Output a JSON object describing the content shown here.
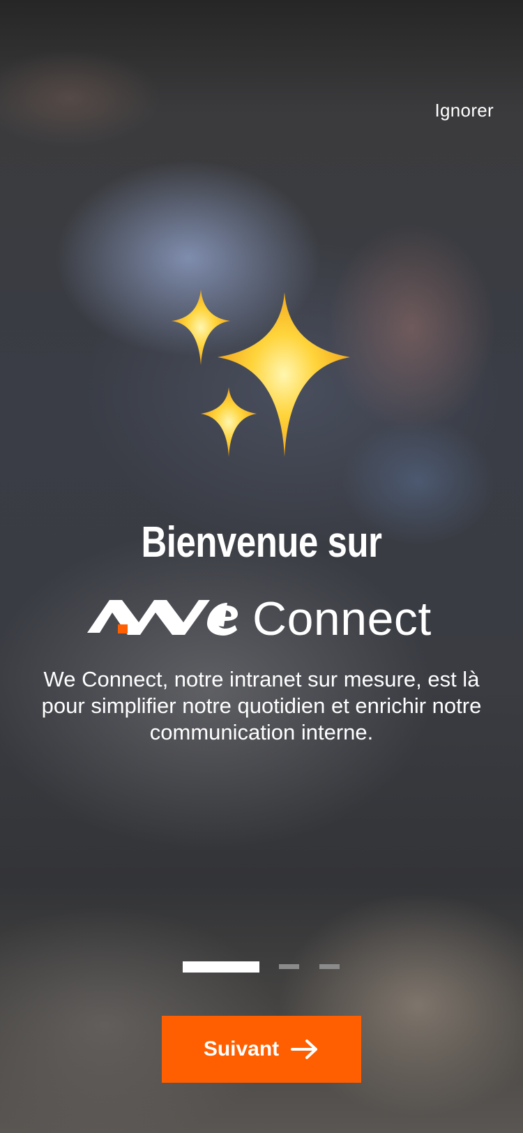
{
  "header": {
    "skip_label": "Ignorer"
  },
  "illustration": {
    "icon": "sparkles-icon",
    "colors": [
      "#ffd43b",
      "#f5a81c"
    ]
  },
  "welcome": {
    "title": "Bienvenue sur",
    "brand_name": "Connect",
    "brand_logo": "We-logo",
    "description": "We Connect, notre intranet sur mesure, est là pour simplifier notre quotidien et enrichir notre communication interne."
  },
  "pagination": {
    "total": 3,
    "current": 1
  },
  "footer": {
    "next_label": "Suivant",
    "next_icon": "arrow-right-icon"
  },
  "colors": {
    "accent": "#ff5f00",
    "text": "#ffffff",
    "dot_active": "#ffffff",
    "dot_inactive": "#8b8b8b"
  }
}
